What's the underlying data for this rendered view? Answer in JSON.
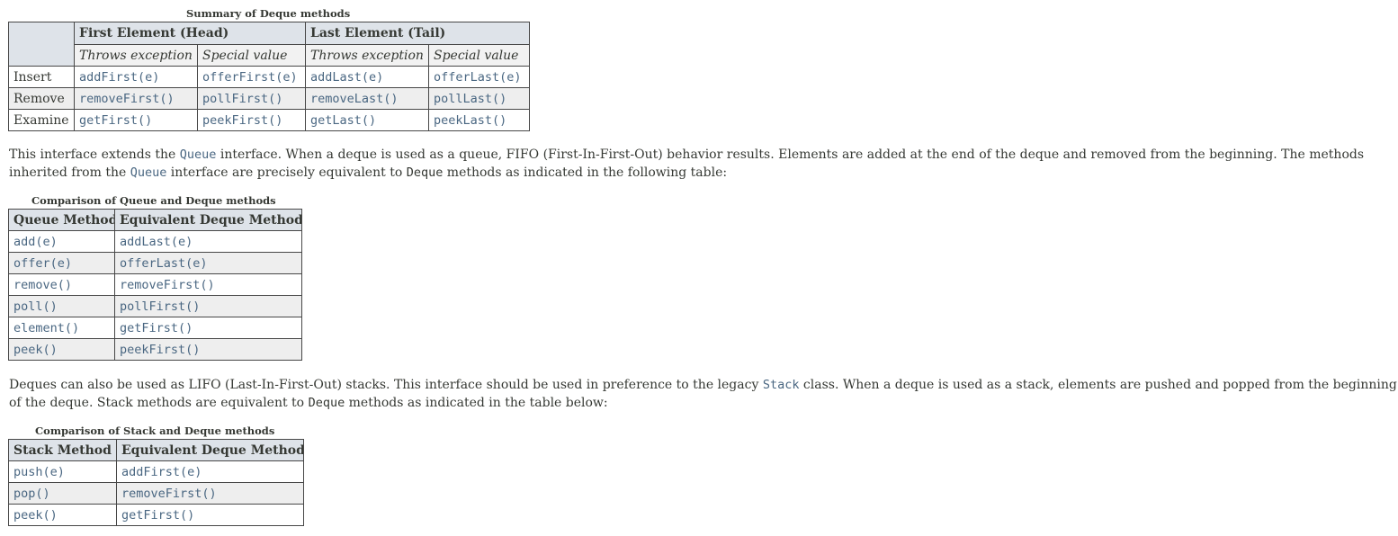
{
  "summary": {
    "caption": "Summary of Deque methods",
    "group_head": "First Element (Head)",
    "group_tail": "Last Element (Tail)",
    "sub_throws": "Throws exception",
    "sub_special": "Special value",
    "rows": [
      {
        "label": "Insert",
        "c1": "addFirst(e)",
        "c2": "offerFirst(e)",
        "c3": "addLast(e)",
        "c4": "offerLast(e)"
      },
      {
        "label": "Remove",
        "c1": "removeFirst()",
        "c2": "pollFirst()",
        "c3": "removeLast()",
        "c4": "pollLast()"
      },
      {
        "label": "Examine",
        "c1": "getFirst()",
        "c2": "peekFirst()",
        "c3": "getLast()",
        "c4": "peekLast()"
      }
    ]
  },
  "para1": {
    "t1": "This interface extends the ",
    "code1": "Queue",
    "t2": " interface. When a deque is used as a queue, FIFO (First-In-First-Out) behavior results. Elements are added at the end of the deque and removed from the beginning. The methods inherited from the ",
    "code2": "Queue",
    "t3": " interface are precisely equivalent to ",
    "code3": "Deque",
    "t4": " methods as indicated in the following table:"
  },
  "queue": {
    "caption": "Comparison of Queue and Deque methods",
    "h1": "Queue Method",
    "h2": "Equivalent Deque Method",
    "rows": [
      {
        "a": "add(e)",
        "b": "addLast(e)"
      },
      {
        "a": "offer(e)",
        "b": "offerLast(e)"
      },
      {
        "a": "remove()",
        "b": "removeFirst()"
      },
      {
        "a": "poll()",
        "b": "pollFirst()"
      },
      {
        "a": "element()",
        "b": "getFirst()"
      },
      {
        "a": "peek()",
        "b": "peekFirst()"
      }
    ]
  },
  "para2": {
    "t1": "Deques can also be used as LIFO (Last-In-First-Out) stacks. This interface should be used in preference to the legacy ",
    "code1": "Stack",
    "t2": " class. When a deque is used as a stack, elements are pushed and popped from the beginning of the deque. Stack methods are equivalent to ",
    "code2": "Deque",
    "t3": " methods as indicated in the table below:"
  },
  "stack": {
    "caption": "Comparison of Stack and Deque methods",
    "h1": "Stack Method",
    "h2": "Equivalent Deque Method",
    "rows": [
      {
        "a": "push(e)",
        "b": "addFirst(e)"
      },
      {
        "a": "pop()",
        "b": "removeFirst()"
      },
      {
        "a": "peek()",
        "b": "getFirst()"
      }
    ]
  }
}
